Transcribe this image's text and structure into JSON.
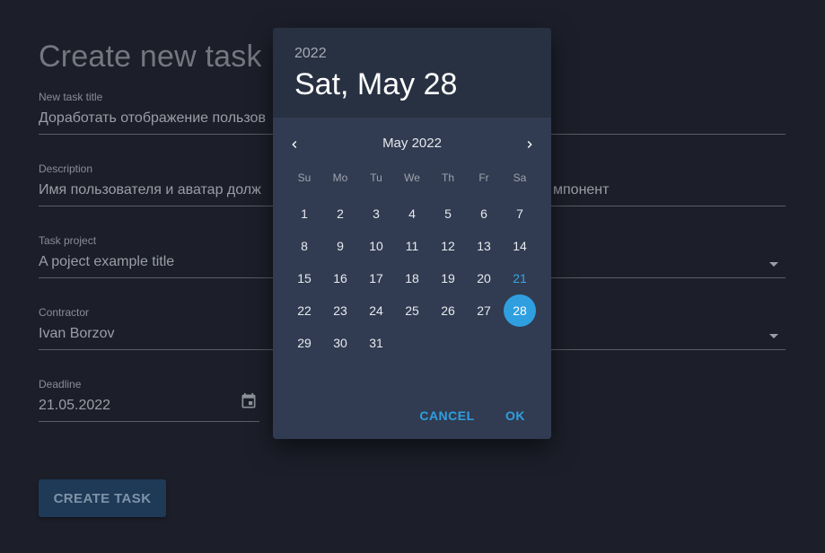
{
  "page": {
    "title": "Create new task"
  },
  "form": {
    "title": {
      "label": "New task title",
      "value": "Доработать отображение пользов"
    },
    "description": {
      "label": "Description",
      "value_left": "Имя пользователя и аватар долж",
      "value_right": "мпонент"
    },
    "project": {
      "label": "Task project",
      "value": "A poject example title"
    },
    "contractor": {
      "label": "Contractor",
      "value": "Ivan Borzov"
    },
    "deadline": {
      "label": "Deadline",
      "value": "21.05.2022"
    },
    "submit_label": "CREATE TASK"
  },
  "datepicker": {
    "year": "2022",
    "selected_label": "Sat, May 28",
    "month_label": "May 2022",
    "weekdays": [
      "Su",
      "Mo",
      "Tu",
      "We",
      "Th",
      "Fr",
      "Sa"
    ],
    "first_weekday_index": 0,
    "days_in_month": 31,
    "today": 21,
    "selected": 28,
    "cancel_label": "CANCEL",
    "ok_label": "OK",
    "colors": {
      "accent": "#2f9fe0",
      "header_bg": "#283142",
      "body_bg": "#313c52"
    }
  }
}
